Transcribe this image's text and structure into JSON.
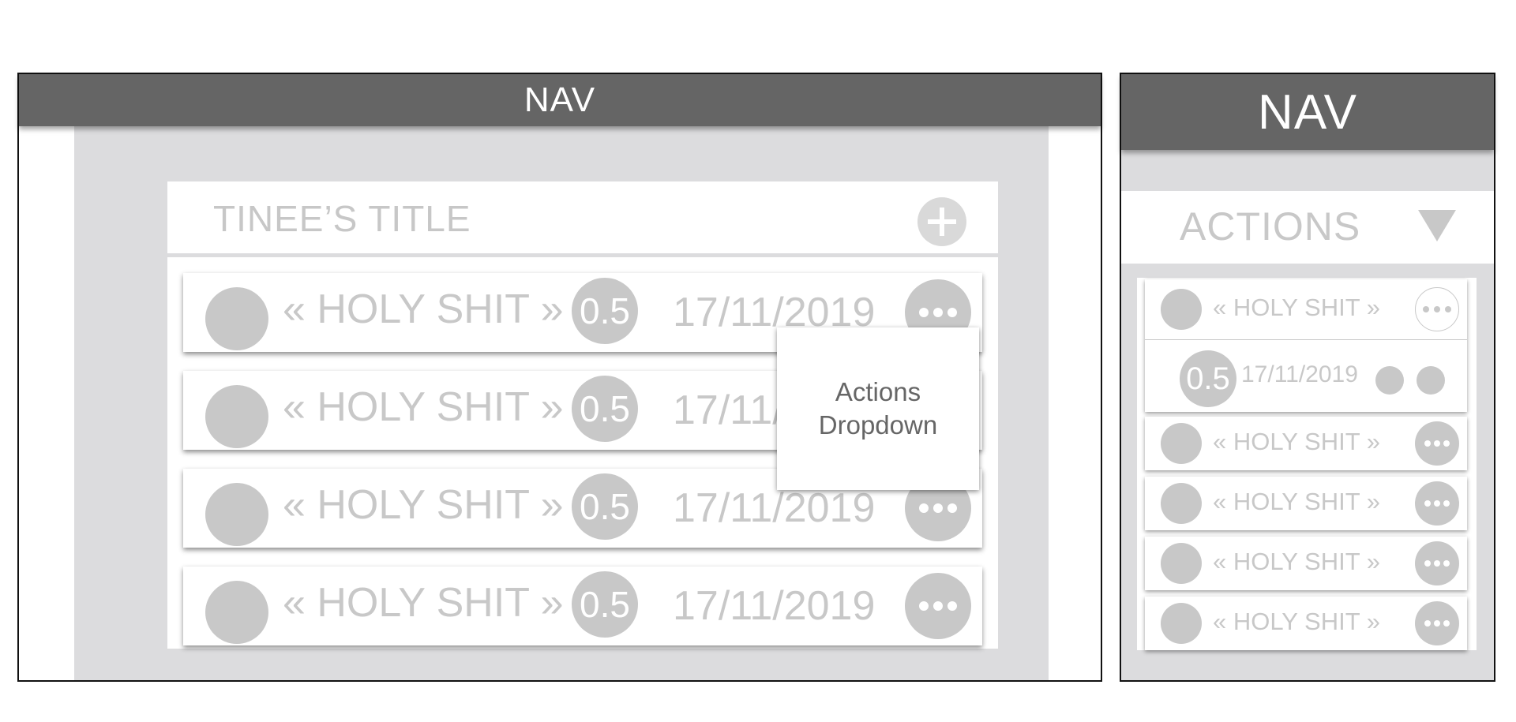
{
  "desktop": {
    "nav_label": "NAV",
    "title": "TINEE’S TITLE",
    "rows": [
      {
        "name": "« HOLY SHIT »",
        "score": "0.5",
        "date": "17/11/2019"
      },
      {
        "name": "« HOLY SHIT »",
        "score": "0.5",
        "date": "17/11/2019"
      },
      {
        "name": "« HOLY SHIT »",
        "score": "0.5",
        "date": "17/11/2019"
      },
      {
        "name": "« HOLY SHIT »",
        "score": "0.5",
        "date": "17/11/2019"
      }
    ],
    "dropdown_line1": "Actions",
    "dropdown_line2": "Dropdown"
  },
  "mobile": {
    "nav_label": "NAV",
    "actions_label": "ACTIONS",
    "expanded_row": {
      "name": "« HOLY SHIT »",
      "score": "0.5",
      "date": "17/11/2019"
    },
    "rows": [
      {
        "name": "« HOLY SHIT »"
      },
      {
        "name": "« HOLY SHIT »"
      },
      {
        "name": "« HOLY SHIT »"
      },
      {
        "name": "« HOLY SHIT »"
      }
    ]
  },
  "colors": {
    "nav": "#656565",
    "background": "#dcdcde",
    "placeholder": "#c8c8c8",
    "dropdown_text": "#666666"
  },
  "icons": {
    "add": "plus-icon",
    "more": "more-dots-icon",
    "expand": "caret-down-icon"
  }
}
